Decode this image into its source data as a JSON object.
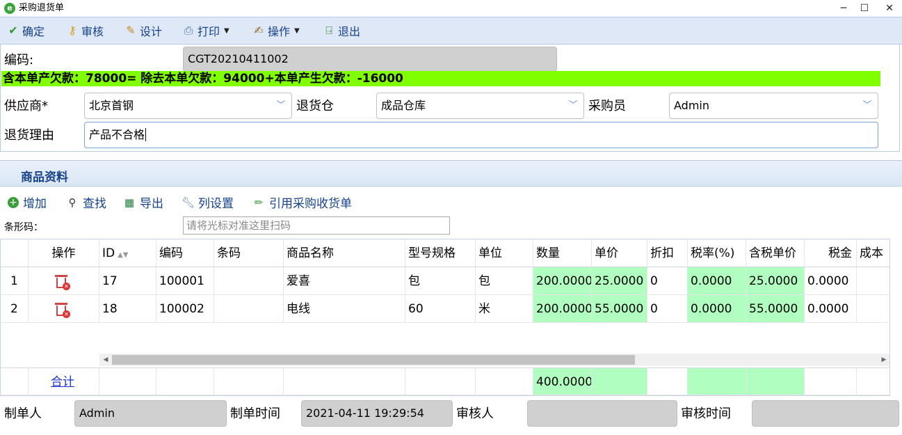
{
  "window": {
    "title": "采购退货单",
    "app_icon": "e",
    "minimize": "─",
    "maximize": "☐",
    "close": "✕"
  },
  "toolbar": {
    "confirm": "确定",
    "review": "审核",
    "design": "设计",
    "print": "打印",
    "operate": "操作",
    "exit": "退出"
  },
  "form": {
    "code_label": "编码:",
    "code_value": "CGT20210411002",
    "debt_text": "含本单产欠款：78000= 除去本单欠款：94000+本单产生欠款：-16000",
    "supplier_label": "供应商*",
    "supplier_value": "北京首钢",
    "warehouse_label": "退货仓",
    "warehouse_value": "成品仓库",
    "buyer_label": "采购员",
    "buyer_value": "Admin",
    "reason_label": "退货理由",
    "reason_value": "产品不合格"
  },
  "section": {
    "title": "商品资料"
  },
  "grid_toolbar": {
    "add": "增加",
    "find": "查找",
    "export": "导出",
    "columns": "列设置",
    "import": "引用采购收货单"
  },
  "barcode": {
    "label": "条形码：",
    "placeholder": "请将光标对准这里扫码"
  },
  "grid": {
    "headers": [
      "操作",
      "ID",
      "编码",
      "条码",
      "商品名称",
      "型号规格",
      "单位",
      "数量",
      "单价",
      "折扣",
      "税率(%)",
      "含税单价",
      "税金",
      "成本"
    ],
    "rows": [
      {
        "no": "1",
        "id": "17",
        "code": "100001",
        "barcode": "",
        "name": "爱喜",
        "spec": "包",
        "unit": "包",
        "qty": "200.0000",
        "price": "25.0000",
        "discount": "0",
        "tax_rate": "0.0000",
        "tax_price": "25.0000",
        "tax": "0.0000"
      },
      {
        "no": "2",
        "id": "18",
        "code": "100002",
        "barcode": "",
        "name": "电线",
        "spec": "60",
        "unit": "米",
        "qty": "200.0000",
        "price": "55.0000",
        "discount": "0",
        "tax_rate": "0.0000",
        "tax_price": "55.0000",
        "tax": "0.0000"
      }
    ],
    "summary_label": "合计",
    "summary_qty": "400.0000"
  },
  "footer": {
    "maker_label": "制单人",
    "maker_value": "Admin",
    "make_time_label": "制单时间",
    "make_time_value": "2021-04-11 19:29:54",
    "reviewer_label": "审核人",
    "reviewer_value": "",
    "review_time_label": "审核时间",
    "review_time_value": ""
  },
  "colors": {
    "debt_bar": "#80ff00",
    "numeric_cell": "#b0ffc0",
    "toolbar_bg": "#dfe8f6",
    "link": "#15428b"
  }
}
